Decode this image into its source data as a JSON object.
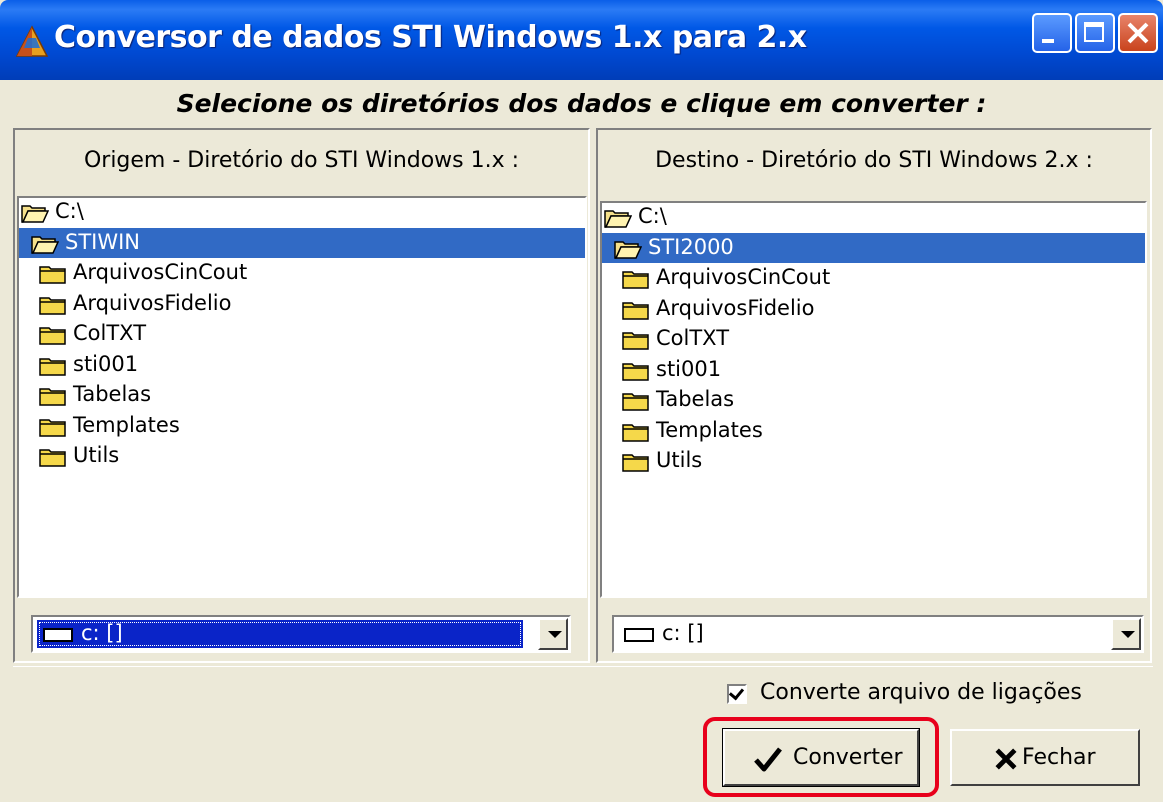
{
  "window": {
    "title": "Conversor de dados STI Windows 1.x para 2.x",
    "icon": "app-pyramid-icon",
    "controls": [
      "minimize-icon",
      "maximize-icon",
      "close-icon"
    ]
  },
  "heading": "Selecione os diretórios dos dados e clique em converter :",
  "source": {
    "label": "Origem - Diretório do STI Windows 1.x :",
    "tree": [
      {
        "name": "C:\\",
        "level": 0,
        "icon": "open-folder-icon",
        "selected": false
      },
      {
        "name": "STIWIN",
        "level": 1,
        "icon": "open-folder-icon",
        "selected": true
      },
      {
        "name": "ArquivosCinCout",
        "level": 2,
        "icon": "folder-icon",
        "selected": false
      },
      {
        "name": "ArquivosFidelio",
        "level": 2,
        "icon": "folder-icon",
        "selected": false
      },
      {
        "name": "ColTXT",
        "level": 2,
        "icon": "folder-icon",
        "selected": false
      },
      {
        "name": "sti001",
        "level": 2,
        "icon": "folder-icon",
        "selected": false
      },
      {
        "name": "Tabelas",
        "level": 2,
        "icon": "folder-icon",
        "selected": false
      },
      {
        "name": "Templates",
        "level": 2,
        "icon": "folder-icon",
        "selected": false
      },
      {
        "name": "Utils",
        "level": 2,
        "icon": "folder-icon",
        "selected": false
      }
    ],
    "drive": "c: []"
  },
  "destination": {
    "label": "Destino - Diretório do STI Windows 2.x :",
    "tree": [
      {
        "name": "C:\\",
        "level": 0,
        "icon": "open-folder-icon",
        "selected": false
      },
      {
        "name": "STI2000",
        "level": 1,
        "icon": "open-folder-icon",
        "selected": true
      },
      {
        "name": "ArquivosCinCout",
        "level": 2,
        "icon": "folder-icon",
        "selected": false
      },
      {
        "name": "ArquivosFidelio",
        "level": 2,
        "icon": "folder-icon",
        "selected": false
      },
      {
        "name": "ColTXT",
        "level": 2,
        "icon": "folder-icon",
        "selected": false
      },
      {
        "name": "sti001",
        "level": 2,
        "icon": "folder-icon",
        "selected": false
      },
      {
        "name": "Tabelas",
        "level": 2,
        "icon": "folder-icon",
        "selected": false
      },
      {
        "name": "Templates",
        "level": 2,
        "icon": "folder-icon",
        "selected": false
      },
      {
        "name": "Utils",
        "level": 2,
        "icon": "folder-icon",
        "selected": false
      }
    ],
    "drive": "c: []"
  },
  "options": {
    "convert_calls_label": "Converte arquivo de ligações",
    "convert_calls_checked": true
  },
  "buttons": {
    "convert": "Converter",
    "close": "Fechar"
  },
  "colors": {
    "titlebar": "#0055E5",
    "selection": "#316AC5",
    "window_bg": "#ECE9D8",
    "highlight_frame": "#E8001C"
  }
}
